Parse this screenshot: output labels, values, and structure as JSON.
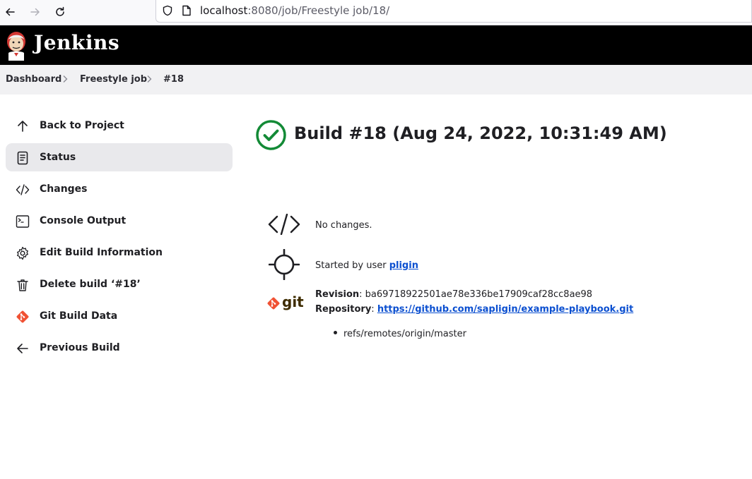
{
  "browser": {
    "url_host": "localhost",
    "url_rest": ":8080/job/Freestyle job/18/"
  },
  "header": {
    "brand": "Jenkins"
  },
  "breadcrumb": [
    {
      "label": "Dashboard"
    },
    {
      "label": "Freestyle job"
    },
    {
      "label": "#18"
    }
  ],
  "sidebar": {
    "items": [
      {
        "label": "Back to Project",
        "icon": "arrow-up-icon"
      },
      {
        "label": "Status",
        "icon": "document-icon",
        "active": true
      },
      {
        "label": "Changes",
        "icon": "code-icon"
      },
      {
        "label": "Console Output",
        "icon": "terminal-icon"
      },
      {
        "label": "Edit Build Information",
        "icon": "gear-icon"
      },
      {
        "label": "Delete build ‘#18’",
        "icon": "trash-icon"
      },
      {
        "label": "Git Build Data",
        "icon": "git-icon"
      },
      {
        "label": "Previous Build",
        "icon": "arrow-left-icon"
      }
    ]
  },
  "main": {
    "build_title": "Build #18 (Aug 24, 2022, 10:31:49 AM)",
    "status_icon": "success-check-icon",
    "status_color": "#138a36",
    "changes_text": "No changes.",
    "started_prefix": "Started by user ",
    "started_user": "pligin",
    "git_word": "git",
    "revision_label": "Revision",
    "revision_value": "ba69718922501ae78e336be17909caf28cc8ae98",
    "repository_label": "Repository",
    "repository_url": "https://github.com/sapligin/example-playbook.git",
    "branches": [
      "refs/remotes/origin/master"
    ]
  },
  "colors": {
    "link": "#0b4fd0",
    "git_orange": "#f05133",
    "header_bg": "#000000"
  }
}
